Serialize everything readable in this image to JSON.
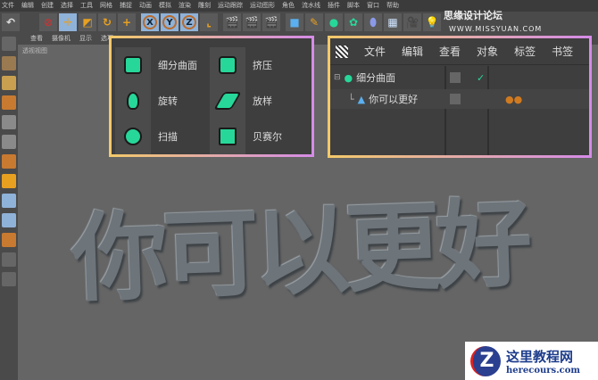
{
  "menubar": [
    "文件",
    "编辑",
    "创建",
    "选择",
    "工具",
    "网格",
    "捕捉",
    "动画",
    "模拟",
    "渲染",
    "雕刻",
    "运动跟踪",
    "运动图形",
    "角色",
    "流水线",
    "插件",
    "脚本",
    "窗口",
    "帮助"
  ],
  "toolbar": {
    "axes": [
      "X",
      "Y",
      "Z"
    ]
  },
  "watermark": {
    "cn": "思缘设计论坛",
    "url": "WWW.MISSYUAN.COM"
  },
  "viewport": {
    "menu": [
      "查看",
      "摄像机",
      "显示",
      "选项"
    ],
    "label": "透视视图",
    "text3d": "你可以更好"
  },
  "generators": [
    {
      "label": "细分曲面",
      "icon": "subdivision-surface-icon"
    },
    {
      "label": "挤压",
      "icon": "extrude-icon"
    },
    {
      "label": "旋转",
      "icon": "lathe-icon"
    },
    {
      "label": "放样",
      "icon": "loft-icon"
    },
    {
      "label": "扫描",
      "icon": "sweep-icon"
    },
    {
      "label": "贝赛尔",
      "icon": "bezier-icon"
    }
  ],
  "object_manager": {
    "menu": [
      "文件",
      "编辑",
      "查看",
      "对象",
      "标签",
      "书签"
    ],
    "objects": [
      {
        "name": "细分曲面"
      },
      {
        "name": "你可以更好"
      }
    ]
  },
  "logo": {
    "title": "这里教程网",
    "url": "herecours.com",
    "letter": "Z"
  }
}
